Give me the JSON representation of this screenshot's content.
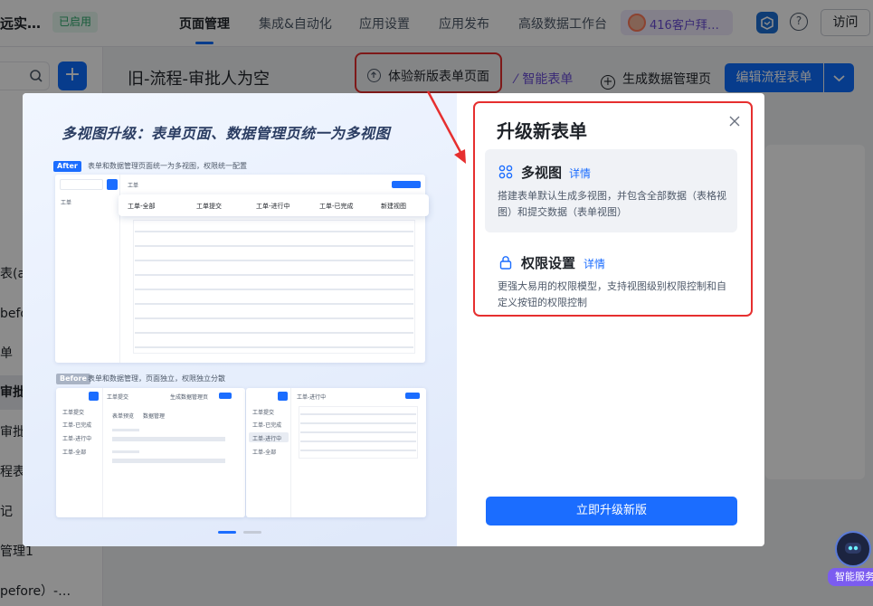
{
  "header": {
    "app_title": "远实…",
    "status_badge": "已启用",
    "nav_tabs": [
      "页面管理",
      "集成&自动化",
      "应用设置",
      "应用发布",
      "高级数据工作台"
    ],
    "customer_chip": "416客户拜…",
    "help_glyph": "?",
    "visit_label": "访问"
  },
  "sidebar": {
    "add_glyph": "+",
    "items": [
      "表(af",
      "befo",
      "单",
      "审批",
      "审批",
      "程表",
      "记",
      "管理1",
      "pefore）-…"
    ]
  },
  "page": {
    "title": "旧-流程-审批人为空",
    "try_new_label": "体验新版表单页面",
    "smart_form_label": "智能表单",
    "gen_data_label": "生成数据管理页",
    "edit_flow_label": "编辑流程表单"
  },
  "modal": {
    "headline": "多视图升级：表单页面、数据管理页统一为多视图",
    "after_tag": "After",
    "after_desc": "表单和数据管理页面统一为多视图，权限统一配置",
    "before_tag": "Before",
    "before_desc": "表单和数据管理，页面独立，权限独立分散",
    "preview": {
      "sidebar_item": "工单",
      "top_title": "工单",
      "tabs": [
        "工单-全部",
        "工单提交",
        "工单-进行中",
        "工单-已完成",
        "新建视图"
      ],
      "before_left_items": [
        "工单提交",
        "工单-已完成",
        "工单-进行中",
        "工单-全部"
      ],
      "before_title_a": "工单提交",
      "before_link_a": "生成数据管理页",
      "before_tabs_a": [
        "表单预览",
        "数据管理"
      ],
      "before_title_b": "工单-进行中"
    },
    "right": {
      "title": "升级新表单",
      "features": [
        {
          "icon": "grid-icon",
          "title": "多视图",
          "link": "详情",
          "desc": "搭建表单默认生成多视图，并包含全部数据（表格视图）和提交数据（表单视图）"
        },
        {
          "icon": "lock-icon",
          "title": "权限设置",
          "link": "详情",
          "desc": "更强大易用的权限模型，支持视图级别权限控制和自定义按钮的权限控制"
        }
      ],
      "upgrade_button": "立即升级新版"
    }
  },
  "assistant": {
    "label": "智能服务"
  },
  "colors": {
    "accent": "#0e6eff",
    "highlight_red": "#e62f2f",
    "smart_purple": "#6a4dd6"
  }
}
